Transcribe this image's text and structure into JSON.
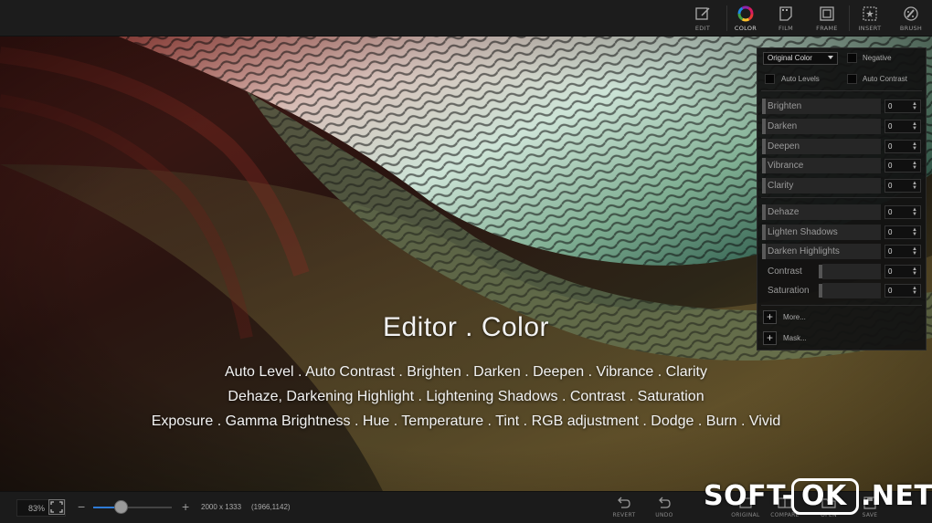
{
  "toolbar": {
    "tools": [
      {
        "label": "EDIT",
        "icon": "edit-icon"
      },
      {
        "label": "COLOR",
        "icon": "color-wheel-icon",
        "active": true
      },
      {
        "label": "FILM",
        "icon": "film-icon"
      },
      {
        "label": "FRAME",
        "icon": "frame-icon"
      },
      {
        "label": "INSERT",
        "icon": "insert-icon"
      },
      {
        "label": "BRUSH",
        "icon": "brush-icon"
      }
    ]
  },
  "overlay": {
    "title": "Editor . Color",
    "line1": "Auto Level . Auto Contrast . Brighten . Darken . Deepen . Vibrance . Clarity",
    "line2": "Dehaze, Darkening Highlight . Lightening Shadows . Contrast . Saturation",
    "line3": "Exposure . Gamma Brightness . Hue . Temperature . Tint . RGB adjustment . Dodge . Burn . Vivid"
  },
  "panel": {
    "color_mode": "Original Color",
    "negative_label": "Negative",
    "auto_levels_label": "Auto Levels",
    "auto_contrast_label": "Auto Contrast",
    "sliders": [
      {
        "label": "Brighten",
        "value": "0"
      },
      {
        "label": "Darken",
        "value": "0"
      },
      {
        "label": "Deepen",
        "value": "0"
      },
      {
        "label": "Vibrance",
        "value": "0"
      },
      {
        "label": "Clarity",
        "value": "0"
      },
      {
        "label": "Dehaze",
        "value": "0"
      },
      {
        "label": "Lighten Shadows",
        "value": "0"
      },
      {
        "label": "Darken Highlights",
        "value": "0"
      },
      {
        "label": "Contrast",
        "value": "0"
      },
      {
        "label": "Saturation",
        "value": "0"
      }
    ],
    "more_label": "More...",
    "mask_label": "Mask..."
  },
  "bottom": {
    "zoom": "83%",
    "zoom_minus": "−",
    "zoom_plus": "+",
    "image_size": "2000 x 1333",
    "cursor_coords": "(1966,1142)",
    "buttons": [
      {
        "label": "REVERT",
        "icon": "revert-icon"
      },
      {
        "label": "UNDO",
        "icon": "undo-icon"
      },
      {
        "label": "ORIGINAL",
        "icon": "original-icon"
      },
      {
        "label": "COMPARE",
        "icon": "compare-icon"
      },
      {
        "label": "OPEN",
        "icon": "open-icon"
      },
      {
        "label": "SAVE",
        "icon": "save-icon"
      }
    ]
  },
  "watermark": {
    "left": "SOFT-",
    "middle": "OK",
    "right": ".NET"
  },
  "colors": {
    "accent": "#2e7bd6",
    "panel_bg": "#121212",
    "toolbar_bg": "#1c1c1c"
  }
}
